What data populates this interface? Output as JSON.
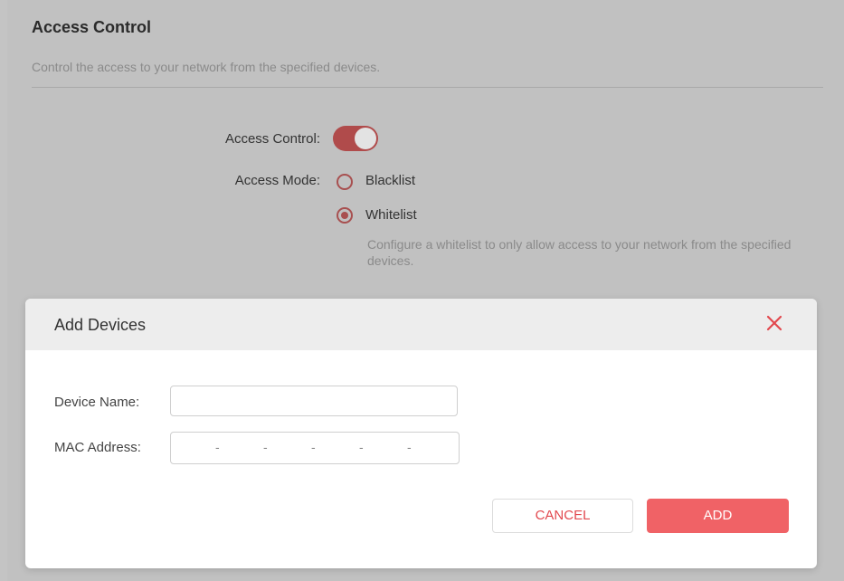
{
  "section": {
    "title": "Access Control",
    "description": "Control the access to your network from the specified devices."
  },
  "access_control": {
    "label": "Access Control:",
    "enabled": true
  },
  "access_mode": {
    "label": "Access Mode:",
    "options": [
      {
        "label": "Blacklist",
        "checked": false
      },
      {
        "label": "Whitelist",
        "checked": true
      }
    ],
    "hint": "Configure a whitelist to only allow access to your network from the specified devices."
  },
  "dialog": {
    "title": "Add Devices",
    "device_name_label": "Device Name:",
    "device_name_value": "",
    "mac_label": "MAC Address:",
    "mac_separator": "-",
    "cancel_label": "CANCEL",
    "add_label": "ADD"
  },
  "colors": {
    "accent": "#f06266",
    "accent_dark": "#b04b4b"
  }
}
